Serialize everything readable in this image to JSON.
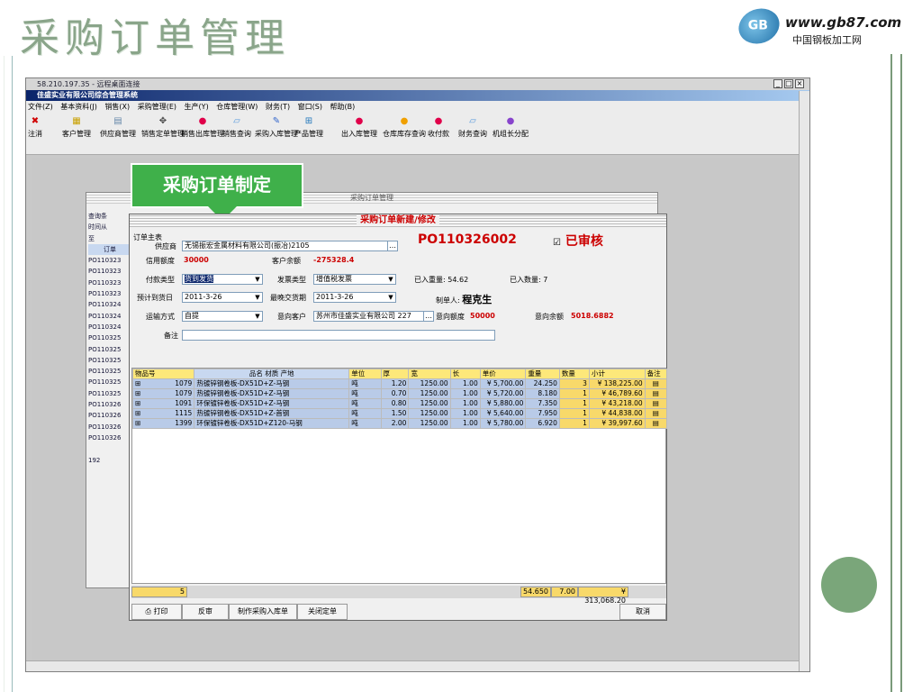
{
  "slide": {
    "title": "采购订单管理"
  },
  "logo": {
    "url": "www.gb87.com",
    "cn": "中国钢板加工网"
  },
  "remote": {
    "title": "58.210.197.35 - 远程桌面连接"
  },
  "app": {
    "title": "佳盛实业有限公司综合管理系统"
  },
  "menu": [
    "文件(Z)",
    "基本资料(J)",
    "销售(X)",
    "采购管理(E)",
    "生产(Y)",
    "仓库管理(W)",
    "财务(T)",
    "窗口(S)",
    "帮助(B)"
  ],
  "toolbar": [
    {
      "label": "注消",
      "icon": "close-icon",
      "color": "#d00000",
      "glyph": "✖"
    },
    {
      "label": "客户管理",
      "icon": "grid-icon",
      "color": "#c8a000",
      "glyph": "▦"
    },
    {
      "label": "供应商管理",
      "icon": "doc-icon",
      "color": "#6688aa",
      "glyph": "▤"
    },
    {
      "label": "销售定单管理",
      "icon": "gear-icon",
      "color": "#444444",
      "glyph": "✥"
    },
    {
      "label": "销售出库管理",
      "icon": "dot-icon",
      "color": "#e0004a",
      "glyph": "●"
    },
    {
      "label": "销售查询",
      "icon": "page-icon",
      "color": "#5599dd",
      "glyph": "▱"
    },
    {
      "label": "采购入库管理",
      "icon": "pen-icon",
      "color": "#3366cc",
      "glyph": "✎"
    },
    {
      "label": "产品管理",
      "icon": "tree-icon",
      "color": "#2277bb",
      "glyph": "⊞"
    },
    {
      "label": "出入库管理",
      "icon": "dot-icon",
      "color": "#e0004a",
      "glyph": "●"
    },
    {
      "label": "仓库库存查询",
      "icon": "dot-icon",
      "color": "#f0a000",
      "glyph": "●"
    },
    {
      "label": "收付款",
      "icon": "dot-icon",
      "color": "#e0004a",
      "glyph": "●"
    },
    {
      "label": "财务查询",
      "icon": "page-icon",
      "color": "#5599dd",
      "glyph": "▱"
    },
    {
      "label": "机组长分配",
      "icon": "dot-icon",
      "color": "#8844cc",
      "glyph": "●"
    }
  ],
  "banner": {
    "text": "采购订单制定"
  },
  "bgwin": {
    "title": "采购订单管理",
    "side": [
      "查询条",
      "时间从",
      "至",
      "订单",
      "PO110323",
      "PO110323",
      "PO110323",
      "PO110323",
      "PO110324",
      "PO110324",
      "PO110324",
      "PO110325",
      "PO110325",
      "PO110325",
      "PO110325",
      "PO110325",
      "PO110325",
      "PO110326",
      "PO110326",
      "PO110326",
      "PO110326",
      "",
      "192"
    ]
  },
  "dialog": {
    "title": "采购订单新建/修改",
    "section": "订单主表",
    "po": "PO110326002",
    "status": "已审核",
    "fields": {
      "supplier_label": "供应商",
      "supplier": "无锡振宏金属材料有限公司(振冶)2105",
      "credit_label": "信用额度",
      "credit": "30000",
      "balance_label": "客户余额",
      "balance": "-275328.4",
      "paytype_label": "付款类型",
      "paytype": "货到发货",
      "invoice_label": "发票类型",
      "invoice": "增值税发票",
      "received_w_label": "已入重量:",
      "received_w": "54.62",
      "received_q_label": "已入数量:",
      "received_q": "7",
      "plan_label": "预计到货日",
      "plan": "2011-3-26",
      "latest_label": "最晚交货期",
      "latest": "2011-3-26",
      "maker_label": "制单人:",
      "maker": "程克生",
      "ship_label": "运输方式",
      "ship": "自提",
      "cust_label": "意向客户",
      "cust": "苏州市佳盛实业有限公司 227",
      "quota_label": "意向额度",
      "quota": "50000",
      "remain_label": "意向余额",
      "remain": "5018.6882",
      "note_label": "备注",
      "note": ""
    },
    "columns": [
      "物品号",
      "品名 材质 产地",
      "单位",
      "厚",
      "宽",
      "长",
      "单价",
      "重量",
      "数量",
      "小计",
      "备注"
    ],
    "rows": [
      [
        "1079",
        "热镀锌钢卷板-DX51D+Z-马钢",
        "吨",
        "1.20",
        "1250.00",
        "1.00",
        "¥ 5,700.00",
        "24.250",
        "3",
        "¥ 138,225.00"
      ],
      [
        "1079",
        "热镀锌钢卷板-DX51D+Z-马钢",
        "吨",
        "0.70",
        "1250.00",
        "1.00",
        "¥ 5,720.00",
        "8.180",
        "1",
        "¥ 46,789.60"
      ],
      [
        "1091",
        "环保镀锌卷板-DX51D+Z-马钢",
        "吨",
        "0.80",
        "1250.00",
        "1.00",
        "¥ 5,880.00",
        "7.350",
        "1",
        "¥ 43,218.00"
      ],
      [
        "1115",
        "热镀锌钢卷板-DX51D+Z-首钢",
        "吨",
        "1.50",
        "1250.00",
        "1.00",
        "¥ 5,640.00",
        "7.950",
        "1",
        "¥ 44,838.00"
      ],
      [
        "1399",
        "环保镀锌卷板-DX51D+Z120-马钢",
        "吨",
        "2.00",
        "1250.00",
        "1.00",
        "¥ 5,780.00",
        "6.920",
        "1",
        "¥ 39,997.60"
      ]
    ],
    "footer": {
      "count": "5",
      "weight": "54.650",
      "qty": "7.00",
      "total": "¥ 313,068.20"
    },
    "buttons": {
      "print": "打印",
      "unaudit": "反审",
      "make_in": "制作采购入库单",
      "close_order": "关闭定单",
      "cancel": "取消"
    }
  }
}
